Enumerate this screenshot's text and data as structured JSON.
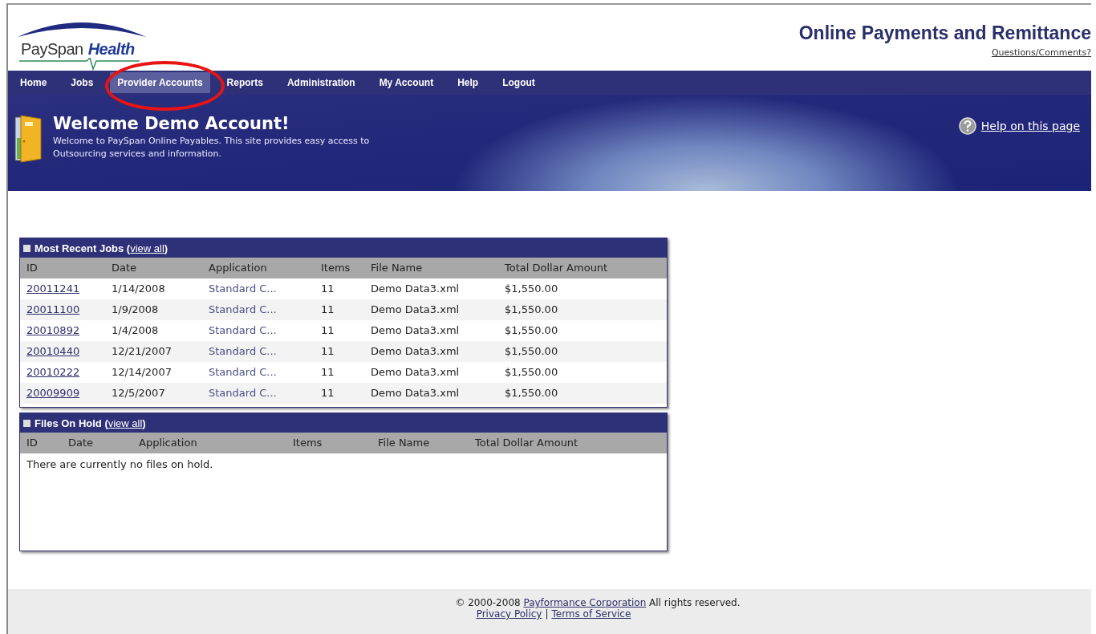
{
  "logo": {
    "name": "PaySpan",
    "accent": "Health"
  },
  "header": {
    "title": "Online Payments and Remittance",
    "link": "Questions/Comments?"
  },
  "nav": [
    {
      "label": "Home",
      "selected": false
    },
    {
      "label": "Jobs",
      "selected": false
    },
    {
      "label": "Provider Accounts",
      "selected": true
    },
    {
      "label": "Reports",
      "selected": false
    },
    {
      "label": "Administration",
      "selected": false
    },
    {
      "label": "My Account",
      "selected": false
    },
    {
      "label": "Help",
      "selected": false
    },
    {
      "label": "Logout",
      "selected": false
    }
  ],
  "banner": {
    "title": "Welcome Demo Account!",
    "text": "Welcome to PaySpan Online Payables. This site provides easy access to Outsourcing services and information.",
    "help": "Help on this page"
  },
  "jobs": {
    "title": "Most Recent Jobs (",
    "link": "view all",
    "title_end": ")",
    "columns": [
      "ID",
      "Date",
      "Application",
      "Items",
      "File Name",
      "Total Dollar Amount"
    ],
    "rows": [
      [
        "20011241",
        "1/14/2008",
        "Standard C...",
        "11",
        "Demo Data3.xml",
        "$1,550.00"
      ],
      [
        "20011100",
        "1/9/2008",
        "Standard C...",
        "11",
        "Demo Data3.xml",
        "$1,550.00"
      ],
      [
        "20010892",
        "1/4/2008",
        "Standard C...",
        "11",
        "Demo Data3.xml",
        "$1,550.00"
      ],
      [
        "20010440",
        "12/21/2007",
        "Standard C...",
        "11",
        "Demo Data3.xml",
        "$1,550.00"
      ],
      [
        "20010222",
        "12/14/2007",
        "Standard C...",
        "11",
        "Demo Data3.xml",
        "$1,550.00"
      ],
      [
        "20009909",
        "12/5/2007",
        "Standard C...",
        "11",
        "Demo Data3.xml",
        "$1,550.00"
      ]
    ]
  },
  "hold": {
    "title": "Files On Hold (",
    "link": "view all",
    "title_end": ")",
    "columns": [
      "ID",
      "Date",
      "Application",
      "Items",
      "File Name",
      "Total Dollar Amount"
    ],
    "empty": "There are currently no files on hold."
  },
  "footer": {
    "before": "© 2000-2008 ",
    "company": "Payformance Corporation",
    "after": " All rights reserved.",
    "privacy": "Privacy Policy",
    "separator": "|",
    "terms": "Terms of Service"
  }
}
